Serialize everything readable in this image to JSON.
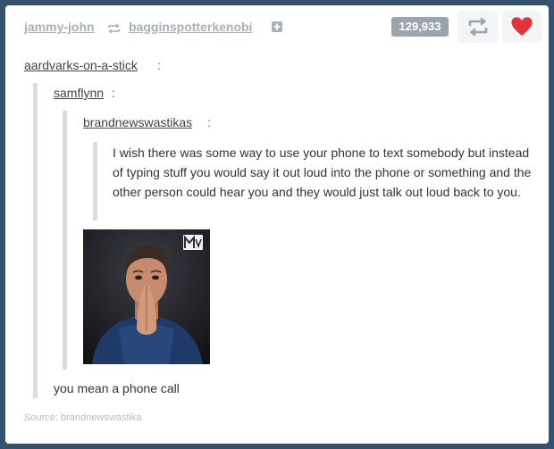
{
  "header": {
    "reblogger": "jammy-john",
    "reblog_icon": "reblog-icon",
    "source_blog": "bagginspotterkenobi",
    "follow_icon": "plus-icon",
    "notes_count": "129,933",
    "reblog_button_icon": "reblog-icon",
    "like_button_icon": "heart-icon",
    "like_color": "#e0343a"
  },
  "thread": {
    "level1_user": "aardvarks-on-a-stick",
    "level2_user": "samflynn",
    "level3_user": "brandnewswastikas",
    "colon": ":",
    "quote": "I wish there was some way to use your phone to text somebody but instead of typing stuff you would say it out loud into the phone or something and the other person could hear you and they would just talk out loud back to you.",
    "gif_watermark": "MTV",
    "reply": "you mean a phone call"
  },
  "footer": {
    "source_label": "Source:",
    "source_value": "brandnewswastika"
  }
}
